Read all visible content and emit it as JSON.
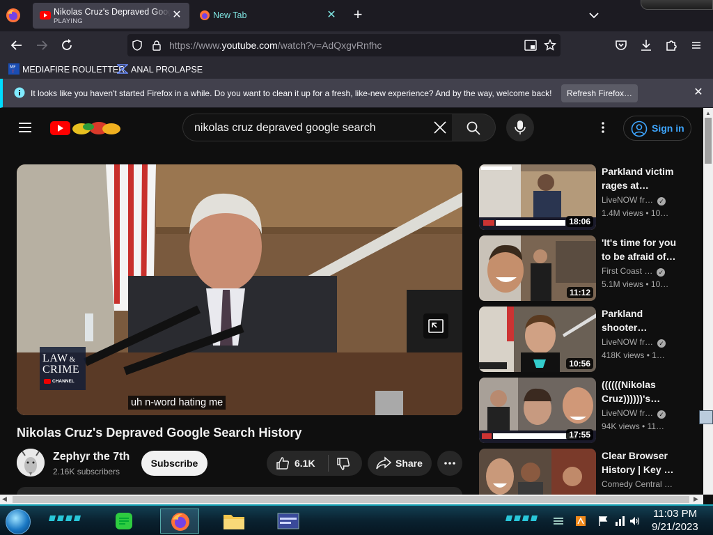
{
  "browser": {
    "tabs": [
      {
        "title": "Nikolas Cruz's Depraved Google Search History - YouTube",
        "subtitle": "PLAYING",
        "active": true
      },
      {
        "title": "New Tab",
        "active": false
      }
    ],
    "url_prefix": "https://www.",
    "url_host": "youtube.com",
    "url_path": "/watch?v=AdQxgvRnfhc",
    "bookmarks": [
      "MEDIAFIRE ROULETTER",
      "ANAL PROLAPSE"
    ],
    "notification": {
      "message": "It looks like you haven't started Firefox in a while. Do you want to clean it up for a fresh, like-new experience? And by the way, welcome back!",
      "button": "Refresh Firefox…"
    }
  },
  "youtube": {
    "search_query": "nikolas cruz depraved google search",
    "sign_in_label": "Sign in",
    "video": {
      "caption": "uh n-word hating me",
      "watermark_line1": "LAW",
      "watermark_amp": "&",
      "watermark_line2": "CRIME",
      "watermark_channel": "CHANNEL",
      "title": "Nikolas Cruz's Depraved Google Search History",
      "channel": "Zephyr the 7th",
      "subscribers": "2.16K subscribers",
      "subscribe_label": "Subscribe",
      "likes": "6.1K",
      "share_label": "Share"
    },
    "recommendations": [
      {
        "title1": "Parkland victim",
        "title2": "rages at…",
        "channel": "LiveNOW fr…",
        "views": "1.4M views",
        "age": "• 10…",
        "duration": "18:06"
      },
      {
        "title1": "'It's time for you",
        "title2": "to be afraid of…",
        "channel": "First Coast …",
        "views": "5.1M views",
        "age": "• 10…",
        "duration": "11:12"
      },
      {
        "title1": "Parkland",
        "title2": "shooter…",
        "channel": "LiveNOW fr…",
        "views": "418K views",
        "age": "• 1…",
        "duration": "10:56"
      },
      {
        "title1": "((((((Nikolas",
        "title2": "Cruz))))))'s…",
        "channel": "LiveNOW fr…",
        "views": "94K views",
        "age": "• 11…",
        "duration": "17:55"
      },
      {
        "title1": "Clear Browser",
        "title2": "History | Key …",
        "channel": "Comedy Central …",
        "views": "",
        "age": "",
        "duration": ""
      }
    ]
  },
  "taskbar": {
    "time": "11:03 PM",
    "date": "9/21/2023"
  },
  "colors": {
    "yt_red": "#ff0000",
    "link_blue": "#3ea6ff",
    "notice_accent": "#00ddff",
    "new_tab_text": "#7ee3e0"
  }
}
